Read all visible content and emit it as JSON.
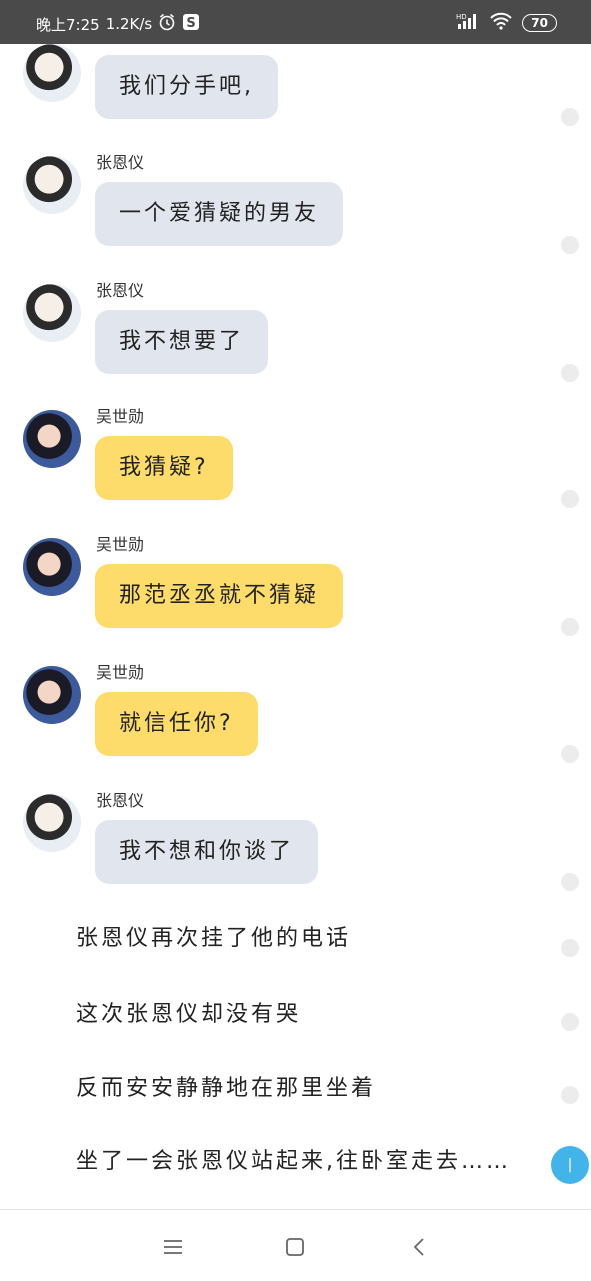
{
  "status_bar": {
    "time": "晚上7:25",
    "speed": "1.2K/s",
    "hd": "HD",
    "battery": "70"
  },
  "messages": [
    {
      "sender": "",
      "type": "girl",
      "bubble": "gray",
      "text": "我们分手吧,"
    },
    {
      "sender": "张恩仪",
      "type": "girl",
      "bubble": "gray",
      "text": "一个爱猜疑的男友"
    },
    {
      "sender": "张恩仪",
      "type": "girl",
      "bubble": "gray",
      "text": "我不想要了"
    },
    {
      "sender": "吴世勋",
      "type": "boy",
      "bubble": "yellow",
      "text": "我猜疑?"
    },
    {
      "sender": "吴世勋",
      "type": "boy",
      "bubble": "yellow",
      "text": "那范丞丞就不猜疑"
    },
    {
      "sender": "吴世勋",
      "type": "boy",
      "bubble": "yellow",
      "text": "就信任你?"
    },
    {
      "sender": "张恩仪",
      "type": "girl",
      "bubble": "gray",
      "text": "我不想和你谈了"
    }
  ],
  "narration": [
    "张恩仪再次挂了他的电话",
    "这次张恩仪却没有哭",
    "反而安安静静地在那里坐着",
    "坐了一会张恩仪站起来,往卧室走去……"
  ],
  "fab_label": "|",
  "nav": {
    "menu_icon": "menu-icon",
    "home_icon": "home-icon",
    "back_icon": "back-icon"
  }
}
